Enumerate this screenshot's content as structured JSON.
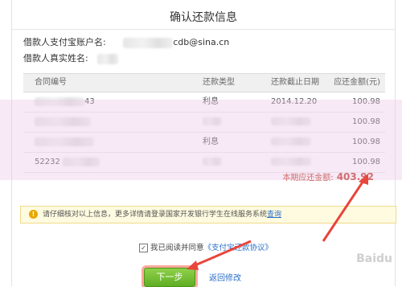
{
  "page": {
    "title": "确认还款信息"
  },
  "account": {
    "alipay_label": "借款人支付宝账户名:",
    "alipay_visible_suffix": "cdb@sina.cn",
    "name_label": "借款人真实姓名:"
  },
  "table": {
    "headers": [
      "合同编号",
      "还款类型",
      "还款截止日期",
      "应还金额(元)"
    ],
    "rows": [
      {
        "contract": "43",
        "type": "利息",
        "date": "2014.12.20",
        "amount": "100.98"
      },
      {
        "contract": "",
        "type": "",
        "date": "",
        "amount": "100.98"
      },
      {
        "contract": "",
        "type": "利息",
        "date": "",
        "amount": "100.98"
      },
      {
        "contract": "52232",
        "type": "",
        "date": "",
        "amount": "100.98"
      }
    ]
  },
  "total": {
    "label": "本期应还金额:",
    "amount": "403.92"
  },
  "notice": {
    "text": "请仔细核对以上信息，更多详情请登录国家开发银行学生在线服务系统",
    "link": "查询"
  },
  "agree": {
    "text": "我已阅读并同意",
    "link": "《支付宝还款协议》",
    "checked": true
  },
  "buttons": {
    "next": "下一步",
    "back": "返回修改"
  },
  "watermark": "Baidu"
}
